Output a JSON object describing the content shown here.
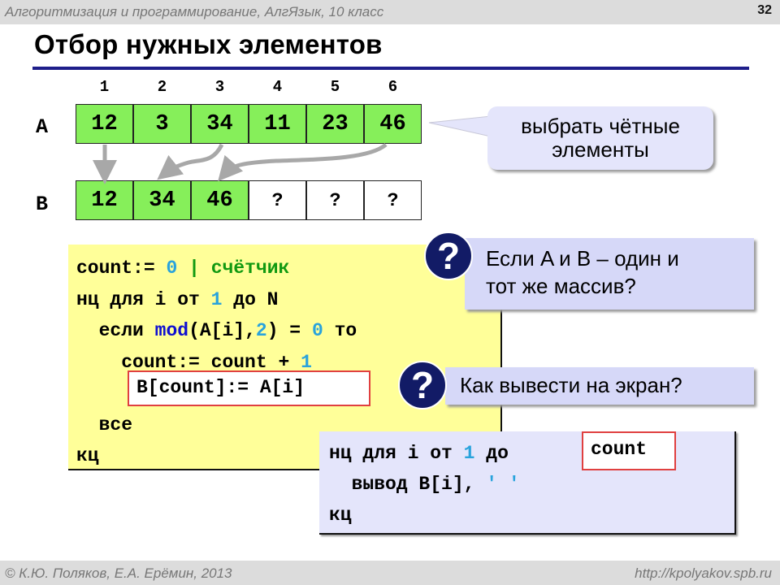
{
  "header": {
    "course": "Алгоритмизация и программирование, АлгЯзык, 10 класс",
    "page_number": "32"
  },
  "title": "Отбор нужных элементов",
  "indices": [
    "1",
    "2",
    "3",
    "4",
    "5",
    "6"
  ],
  "array_a": {
    "label": "A",
    "values": [
      "12",
      "3",
      "34",
      "11",
      "23",
      "46"
    ]
  },
  "array_b": {
    "label": "B",
    "values": [
      "12",
      "34",
      "46",
      "?",
      "?",
      "?"
    ]
  },
  "callout": {
    "line1": "выбрать чётные",
    "line2": "элементы"
  },
  "code_main": {
    "l1_var": "count:=",
    "l1_num": "0",
    "l1_sep": "|",
    "l1_comment": "счётчик",
    "l2_kw": "нц для i от",
    "l2_num": "1",
    "l2_rest": "до N",
    "l3_kw": "если",
    "l3_fn": "mod",
    "l3_arg": "(A[i],",
    "l3_num": "2",
    "l3_eq": ") =",
    "l3_num2": "0",
    "l3_then": "то",
    "l4_expr": "count:= count +",
    "l4_num": "1",
    "l5_highlight": "B[count]:= A[i]",
    "l6": "все",
    "l7": "кц"
  },
  "questions": [
    {
      "icon": "?",
      "line1": "Если A и B – один и",
      "line2": "тот же массив?"
    },
    {
      "icon": "?",
      "line1": "Как вывести на экран?"
    }
  ],
  "code_output": {
    "l1_kw": "нц для i от",
    "l1_num": "1",
    "l1_to": "до",
    "l1_highlight": "count",
    "l2_kw": "вывод B[i],",
    "l2_str": "' '",
    "l3": "кц"
  },
  "footer": {
    "authors": "© К.Ю. Поляков, Е.А. Ерёмин, 2013",
    "url": "http://kpolyakov.spb.ru"
  }
}
